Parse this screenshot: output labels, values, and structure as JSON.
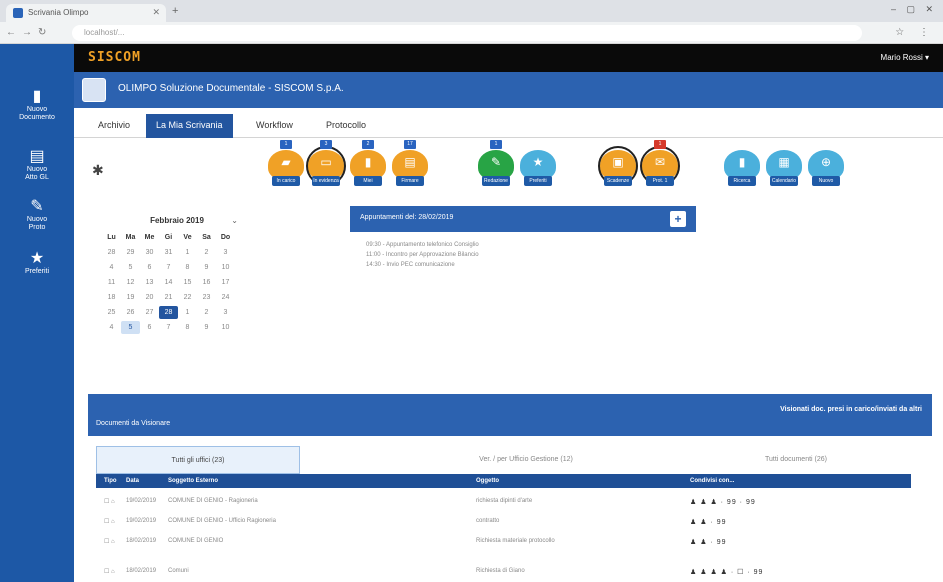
{
  "browser": {
    "tab_title": "Scrivania Olimpo",
    "url": "localhost/...",
    "window_controls": "– ▢ ✕"
  },
  "sidebar": {
    "items": [
      {
        "icon": "document-icon",
        "label_lines": [
          "Nuovo",
          "Documento"
        ]
      },
      {
        "icon": "register-icon",
        "label_lines": [
          "Nuovo",
          "Atto GL"
        ]
      },
      {
        "icon": "edit-icon",
        "label_lines": [
          "Nuovo",
          "Proto"
        ]
      },
      {
        "icon": "star-icon",
        "label_lines": [
          "Preferiti"
        ]
      }
    ]
  },
  "appbar": {
    "logo": "SISCOM",
    "user": "Mario Rossi ▾"
  },
  "titlebar": {
    "title": "OLIMPO Soluzione Documentale - SISCOM S.p.A."
  },
  "main_tabs": [
    {
      "label": "Archivio",
      "active": false
    },
    {
      "label": "La Mia Scrivania",
      "active": true
    },
    {
      "label": "Workflow",
      "active": false
    },
    {
      "label": "Protocollo",
      "active": false
    }
  ],
  "action_groups": [
    {
      "color": "#f0a126",
      "buttons": [
        {
          "caption": "In carico",
          "badge": "1",
          "ring": false
        },
        {
          "caption": "In evidenza",
          "badge": "3",
          "ring": true
        },
        {
          "caption": "Miei",
          "badge": "2",
          "ring": false
        },
        {
          "caption": "Firmare",
          "badge": "17",
          "ring": false
        }
      ]
    },
    {
      "color": "#28a445",
      "buttons": [
        {
          "caption": "Redazione",
          "badge": "1",
          "ring": false
        },
        {
          "caption": "Preferiti",
          "badge": "",
          "ring": false
        }
      ]
    },
    {
      "color": "#f0a126",
      "buttons": [
        {
          "caption": "Scadenze",
          "badge": "",
          "ring": true
        },
        {
          "caption": "Prot. 1",
          "badge": "1",
          "ring": true
        }
      ]
    },
    {
      "color": "#4bb0dc",
      "buttons": [
        {
          "caption": "Ricerca",
          "badge": "",
          "ring": false
        },
        {
          "caption": "Calendario",
          "badge": "",
          "ring": false
        },
        {
          "caption": "Nuovo",
          "badge": "",
          "ring": false
        }
      ]
    }
  ],
  "calendar": {
    "month": "Febbraio 2019",
    "weekdays": [
      "Lu",
      "Ma",
      "Me",
      "Gi",
      "Ve",
      "Sa",
      "Do"
    ],
    "weeks": [
      [
        "28",
        "29",
        "30",
        "31",
        "1",
        "2",
        "3"
      ],
      [
        "4",
        "5",
        "6",
        "7",
        "8",
        "9",
        "10"
      ],
      [
        "11",
        "12",
        "13",
        "14",
        "15",
        "16",
        "17"
      ],
      [
        "18",
        "19",
        "20",
        "21",
        "22",
        "23",
        "24"
      ],
      [
        "25",
        "26",
        "27",
        "28",
        "1",
        "2",
        "3"
      ],
      [
        "4",
        "5",
        "6",
        "7",
        "8",
        "9",
        "10"
      ]
    ],
    "selected_day": "28",
    "today_day": "5"
  },
  "appointments": {
    "title": "Appuntamenti del: 28/02/2019",
    "add_symbol": "+",
    "items": [
      "09:30 - Appuntamento telefonico Consiglio",
      "11:00 - Incontro per Approvazione Bilancio",
      "14:30 - Invio PEC comunicazione"
    ]
  },
  "documents": {
    "section_title": "Documenti da Visionare",
    "link": "Visionati doc. presi in carico/inviati da altri",
    "subtabs": [
      {
        "label": "Tutti gli uffici (23)",
        "active": true
      },
      {
        "label": "Ver. / per Ufficio Gestione (12)",
        "active": false
      },
      {
        "label": "Tutti documenti (26)",
        "active": false
      }
    ],
    "columns": [
      "Tipo",
      "Data",
      "Soggetto Esterno",
      "Oggetto",
      "Condivisi con..."
    ],
    "rows": [
      {
        "tipo": "☐ ⌂",
        "data": "19/02/2019",
        "soggetto": "COMUNE DI GENIO - Ragioneria",
        "oggetto": "richiesta dipinti d'arte",
        "condivisi": "♟ ♟ ♟ · 99 · 99"
      },
      {
        "tipo": "☐ ⌂",
        "data": "19/02/2019",
        "soggetto": "COMUNE DI GENIO - Ufficio Ragioneria",
        "oggetto": "contratto",
        "condivisi": "♟ ♟ · 99"
      },
      {
        "tipo": "☐ ⌂",
        "data": "18/02/2019",
        "soggetto": "COMUNE DI GENIO",
        "oggetto": "Richiesta materiale protocollo",
        "condivisi": "♟ ♟ · 99"
      },
      {
        "tipo": "☐ ⌂",
        "data": "18/02/2019",
        "soggetto": "Comuni",
        "oggetto": "Richiesta di Giano",
        "condivisi": "♟ ♟ ♟ ♟ · ☐ · 99"
      }
    ]
  }
}
